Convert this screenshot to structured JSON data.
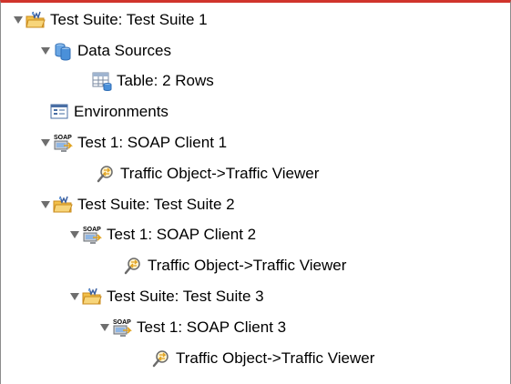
{
  "tree": {
    "nodes": [
      {
        "label": "Test Suite: Test Suite 1",
        "icon": "test-suite-icon",
        "expanded": true
      },
      {
        "label": "Data Sources",
        "icon": "data-sources-icon",
        "expanded": true
      },
      {
        "label": "Table: 2 Rows",
        "icon": "table-icon"
      },
      {
        "label": "Environments",
        "icon": "environments-icon"
      },
      {
        "label": "Test 1: SOAP Client 1",
        "icon": "soap-client-icon",
        "expanded": true
      },
      {
        "label": "Traffic Object->Traffic Viewer",
        "icon": "traffic-viewer-icon"
      },
      {
        "label": "Test Suite: Test Suite 2",
        "icon": "test-suite-icon",
        "expanded": true
      },
      {
        "label": "Test 1: SOAP Client 2",
        "icon": "soap-client-icon",
        "expanded": true
      },
      {
        "label": "Traffic Object->Traffic Viewer",
        "icon": "traffic-viewer-icon"
      },
      {
        "label": "Test Suite: Test Suite 3",
        "icon": "test-suite-icon",
        "expanded": true
      },
      {
        "label": "Test 1: SOAP Client 3",
        "icon": "soap-client-icon",
        "expanded": true
      },
      {
        "label": "Traffic Object->Traffic Viewer",
        "icon": "traffic-viewer-icon"
      }
    ]
  },
  "colors": {
    "frame_top_border": "#d0342c",
    "frame_side_border": "#8c8c8c",
    "twisty": "#6e6e6e",
    "folder": "#f2c04a",
    "folder_dark": "#c98a1b",
    "db_blue": "#4a90d9",
    "soap_gray": "#8a8f97"
  }
}
